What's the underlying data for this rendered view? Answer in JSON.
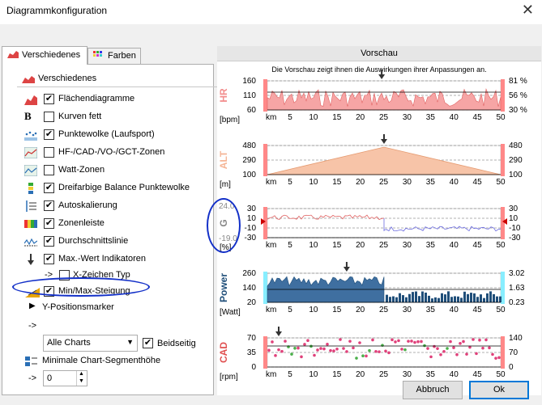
{
  "window": {
    "title": "Diagrammkonfiguration",
    "close_glyph": "✕"
  },
  "tabs": [
    {
      "label": "Verschiedenes",
      "icon": "area-chart-icon"
    },
    {
      "label": "Farben",
      "icon": "palette-icon"
    }
  ],
  "left": {
    "group_label": "Verschiedenes",
    "options": [
      {
        "label": "Flächendiagramme",
        "checked": true,
        "icon": "area-chart-icon"
      },
      {
        "label": "Kurven fett",
        "checked": false,
        "icon": "bold-icon"
      },
      {
        "label": "Punktewolke (Laufsport)",
        "checked": true,
        "icon": "scatter-icon"
      },
      {
        "label": "HF-/CAD-/VO-/GCT-Zonen",
        "checked": false,
        "icon": "zones-icon"
      },
      {
        "label": "Watt-Zonen",
        "checked": false,
        "icon": "watt-zones-icon"
      },
      {
        "label": "Dreifarbige Balance Punktewolke",
        "checked": true,
        "icon": "tricolor-icon"
      },
      {
        "label": "Autoskalierung",
        "checked": true,
        "icon": "autoscale-icon"
      },
      {
        "label": "Zonenleiste",
        "checked": true,
        "icon": "zone-bar-icon"
      },
      {
        "label": "Durchschnittslinie",
        "checked": true,
        "icon": "average-line-icon"
      },
      {
        "label": "Max.-Wert Indikatoren",
        "checked": true,
        "icon": "max-arrow-icon"
      }
    ],
    "xmark": {
      "prefix": "->",
      "label": "X-Zeichen Typ",
      "checked": false
    },
    "minmax": {
      "label": "Min/Max-Steigung",
      "checked": true,
      "icon": "slope-icon"
    },
    "ypos": {
      "label": "Y-Positionsmarker",
      "prefix": "->",
      "select_value": "Alle Charts",
      "both_label": "Beidseitig",
      "both_checked": true
    },
    "segment": {
      "label": "Minimale Chart-Segmenthöhe",
      "prefix": "->",
      "value": "0"
    }
  },
  "preview": {
    "title": "Vorschau",
    "description": "Die Vorschau zeigt ihnen die Auswirkungen ihrer Anpassungen an.",
    "x_unit": "km",
    "x_ticks": [
      "5",
      "10",
      "15",
      "20",
      "25",
      "30",
      "35",
      "40",
      "45",
      "50"
    ],
    "charts": [
      {
        "name": "HR",
        "unit": "[bpm]",
        "color": "#f28c8c",
        "left_ticks": [
          "160",
          "110",
          "60"
        ],
        "right_ticks": [
          "81 %",
          "56 %",
          "30 %"
        ]
      },
      {
        "name": "ALT",
        "unit": "[m]",
        "color": "#f5b596",
        "left_ticks": [
          "480",
          "290",
          "100"
        ],
        "right_ticks": [
          "480",
          "290",
          "100"
        ]
      },
      {
        "name": "G",
        "unit": "[%]",
        "color": "#888888",
        "left_ticks": [
          "30",
          "10",
          "-10",
          "-30"
        ],
        "right_ticks": [
          "30",
          "10",
          "-10",
          "-30"
        ],
        "max_label": "24.0",
        "min_label": "-19.0"
      },
      {
        "name": "Power",
        "unit": "[Watt]",
        "color": "#1f4e79",
        "left_ticks": [
          "260",
          "140",
          "20"
        ],
        "right_ticks": [
          "3.02",
          "1.63",
          "0.23"
        ]
      },
      {
        "name": "CAD",
        "unit": "[rpm]",
        "color": "#e05050",
        "left_ticks": [
          "70",
          "35",
          "0"
        ],
        "right_ticks": [
          "140",
          "70",
          "0"
        ]
      }
    ]
  },
  "buttons": {
    "cancel": "Abbruch",
    "ok": "Ok"
  }
}
